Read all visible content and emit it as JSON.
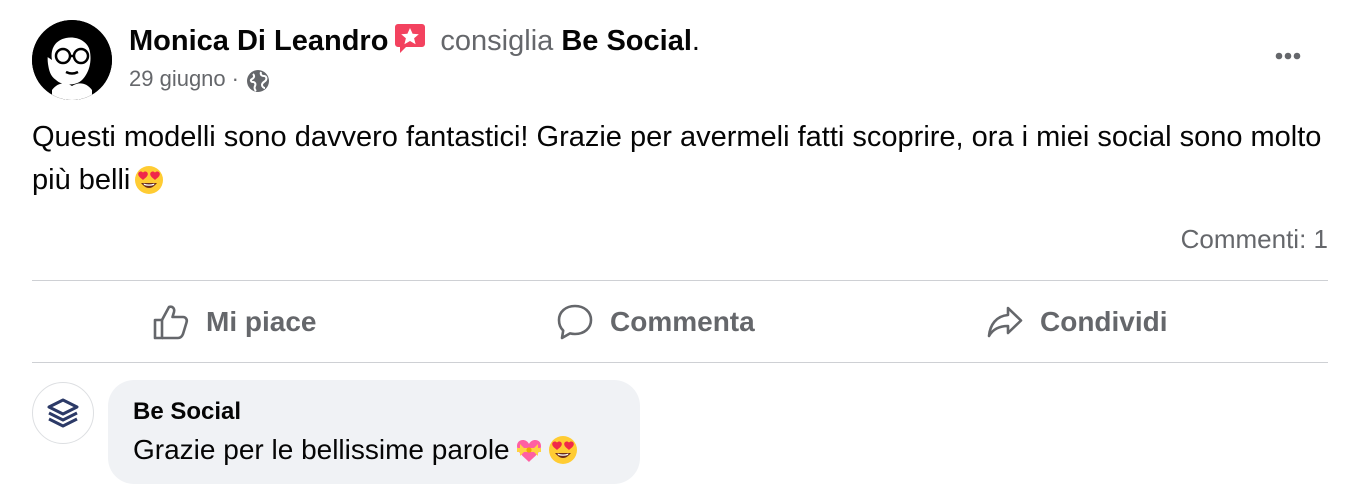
{
  "post": {
    "author": "Monica Di Leandro",
    "verb": "consiglia",
    "page": "Be Social",
    "period": ".",
    "date": "29 giugno",
    "separator": "·",
    "audience_icon": "globe-icon",
    "text": "Questi modelli sono davvero fantastici! Grazie per avermeli fatti scoprire, ora i miei social sono molto più belli",
    "text_emoji": "heart-eyes-emoji",
    "comments_count": "Commenti: 1"
  },
  "actions": {
    "like": "Mi piace",
    "comment": "Commenta",
    "share": "Condividi"
  },
  "comment": {
    "author": "Be Social",
    "text": "Grazie per le bellissime parole",
    "emojis": [
      "heart-with-ribbon-emoji",
      "heart-eyes-emoji"
    ]
  },
  "colors": {
    "text": "#050505",
    "secondary": "#65676b",
    "divider": "#ced0d4",
    "bubble": "#f0f2f5",
    "recommend_badge": "#f3425f"
  }
}
